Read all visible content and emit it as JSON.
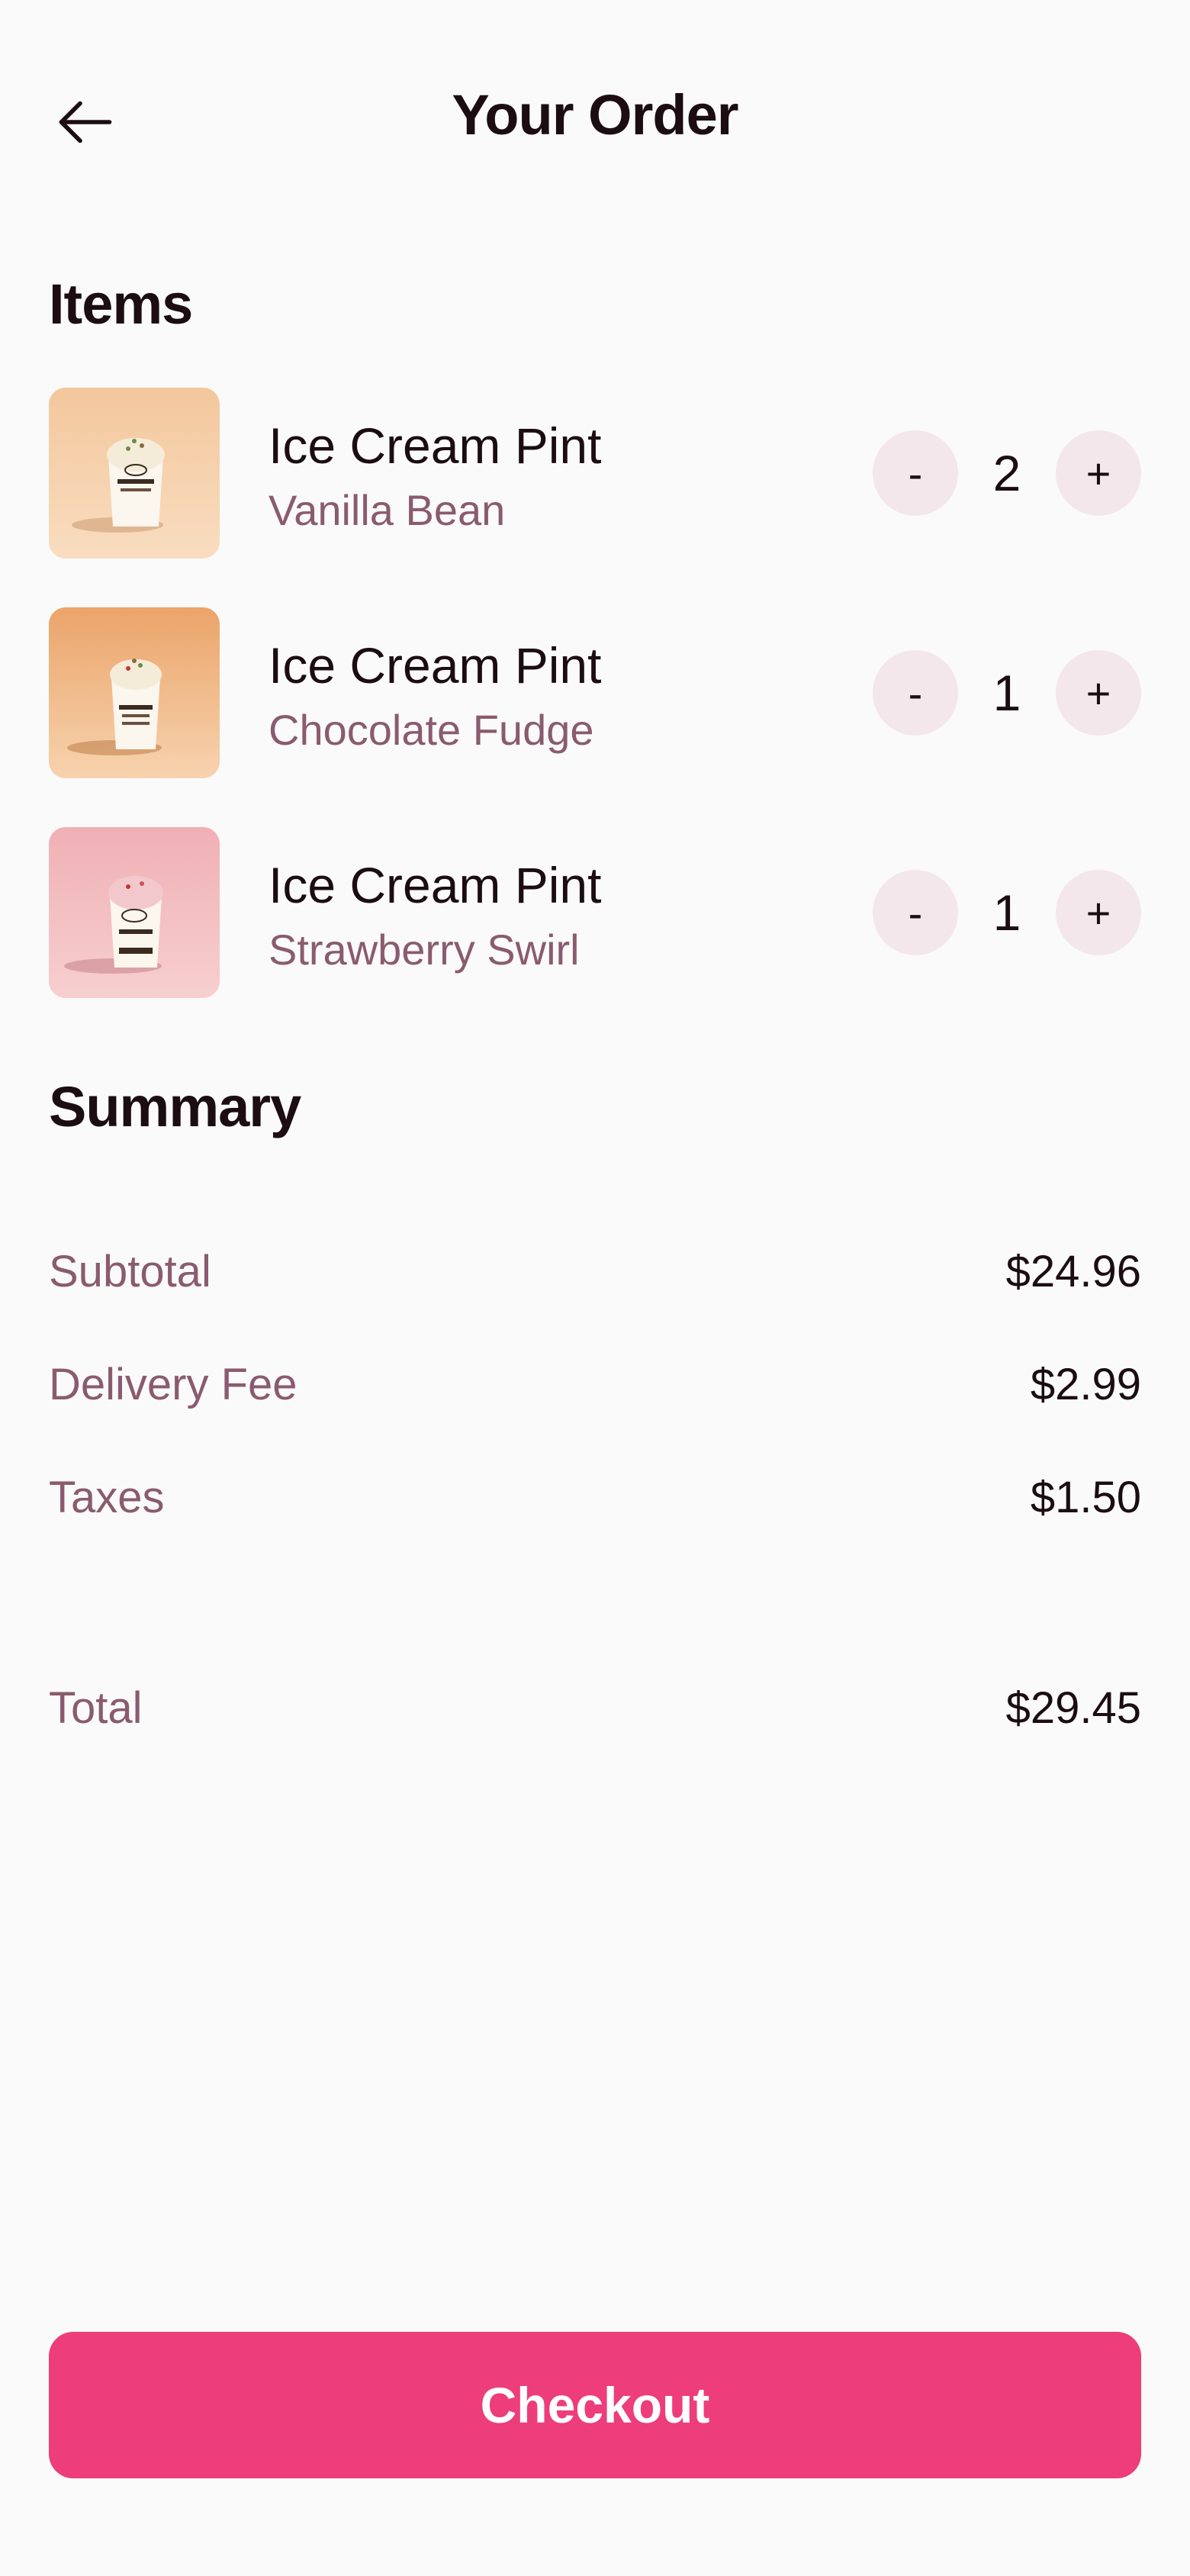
{
  "header": {
    "back_icon": "arrow-left-icon",
    "title": "Your Order"
  },
  "items_section": {
    "title": "Items",
    "items": [
      {
        "name": "Ice Cream Pint",
        "flavor": "Vanilla Bean",
        "quantity": "2",
        "minus_label": "-",
        "plus_label": "+"
      },
      {
        "name": "Ice Cream Pint",
        "flavor": "Chocolate Fudge",
        "quantity": "1",
        "minus_label": "-",
        "plus_label": "+"
      },
      {
        "name": "Ice Cream Pint",
        "flavor": "Strawberry Swirl",
        "quantity": "1",
        "minus_label": "-",
        "plus_label": "+"
      }
    ]
  },
  "summary": {
    "title": "Summary",
    "subtotal_label": "Subtotal",
    "subtotal_value": "$24.96",
    "delivery_label": "Delivery Fee",
    "delivery_value": "$2.99",
    "taxes_label": "Taxes",
    "taxes_value": "$1.50",
    "total_label": "Total",
    "total_value": "$29.45"
  },
  "checkout": {
    "label": "Checkout"
  },
  "colors": {
    "accent": "#ed3d7a",
    "muted_text": "#8a5b6e",
    "stepper_bg": "#f3e7ec",
    "background": "#fafafa"
  }
}
